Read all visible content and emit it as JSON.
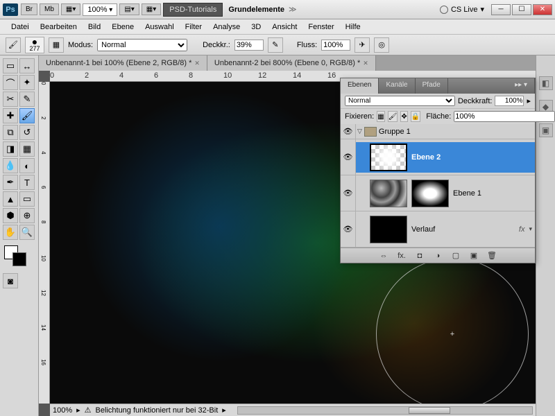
{
  "titlebar": {
    "br": "Br",
    "mb": "Mb",
    "zoom": "100%",
    "psd_tut": "PSD-Tutorials",
    "grund": "Grundelemente",
    "cslive": "CS Live"
  },
  "menu": [
    "Datei",
    "Bearbeiten",
    "Bild",
    "Ebene",
    "Auswahl",
    "Filter",
    "Analyse",
    "3D",
    "Ansicht",
    "Fenster",
    "Hilfe"
  ],
  "optbar": {
    "brush_size": "277",
    "modus_lbl": "Modus:",
    "modus_val": "Normal",
    "deckkr_lbl": "Deckkr.:",
    "deckkr_val": "39%",
    "fluss_lbl": "Fluss:",
    "fluss_val": "100%"
  },
  "tabs": [
    "Unbenannt-1 bei 100% (Ebene 2, RGB/8) *",
    "Unbenannt-2 bei 800% (Ebene 0, RGB/8) *"
  ],
  "ruler_h": [
    "0",
    "2",
    "4",
    "6",
    "8",
    "10",
    "12",
    "14",
    "16"
  ],
  "ruler_v": [
    "0",
    "2",
    "4",
    "6",
    "8",
    "10",
    "12",
    "14",
    "16"
  ],
  "status": {
    "zoom": "100%",
    "msg": "Belichtung funktioniert nur bei 32-Bit"
  },
  "panel": {
    "tabs": [
      "Ebenen",
      "Kanäle",
      "Pfade"
    ],
    "blend": "Normal",
    "deck_lbl": "Deckkraft:",
    "deck_val": "100%",
    "fix_lbl": "Fixieren:",
    "fill_lbl": "Fläche:",
    "fill_val": "100%",
    "group": "Gruppe 1",
    "layer_ebene2": "Ebene 2",
    "layer_ebene1": "Ebene 1",
    "layer_verlauf": "Verlauf",
    "fx": "fx"
  },
  "cursor": "+"
}
